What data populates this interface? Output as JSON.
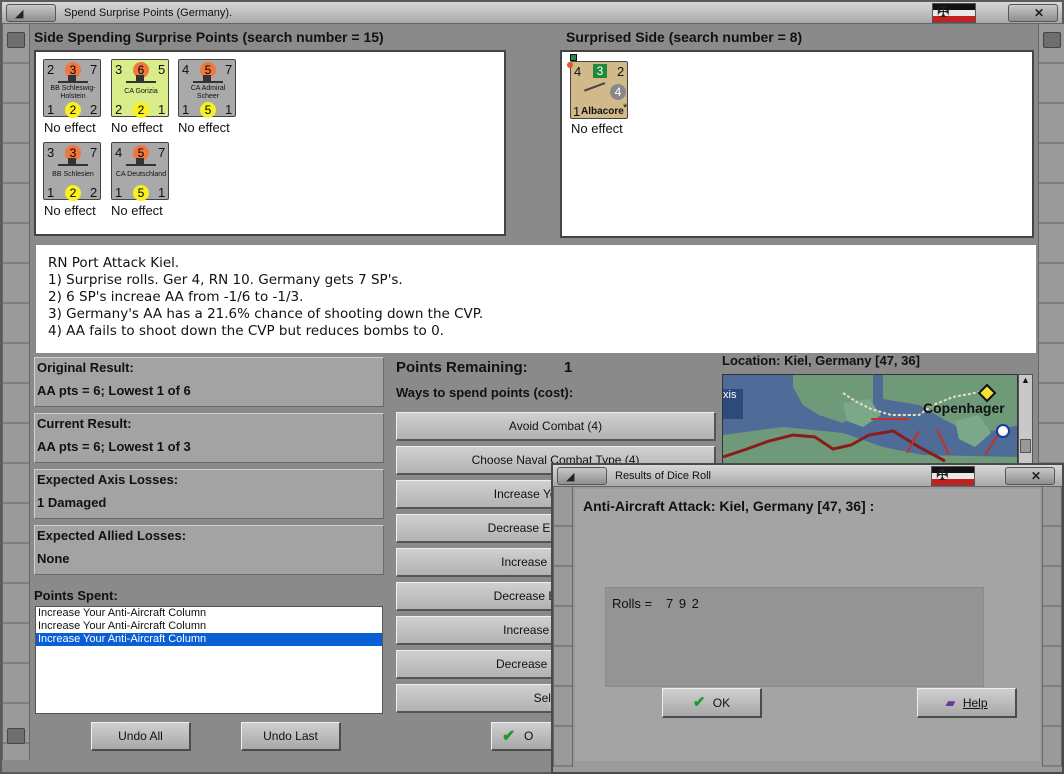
{
  "window": {
    "title": "Spend Surprise Points (Germany)."
  },
  "spending_side": {
    "label": "Side Spending Surprise Points (search number = 15)",
    "units": [
      {
        "top_left": "2",
        "top_mid": "3",
        "top_right": "7",
        "name_line1": "BB Schleswig-",
        "name_line2": "Holstein",
        "bot_left": "1",
        "bot_mid": "2",
        "bot_right": "2",
        "result": "No effect",
        "bg": "#a9a9a9"
      },
      {
        "top_left": "3",
        "top_mid": "6",
        "top_right": "5",
        "name_line1": "CA Gorizia",
        "name_line2": "",
        "bot_left": "2",
        "bot_mid": "2",
        "bot_right": "1",
        "result": "No effect",
        "bg": "#d8ec8a"
      },
      {
        "top_left": "4",
        "top_mid": "5",
        "top_right": "7",
        "name_line1": "CA Admiral",
        "name_line2": "Scheer",
        "bot_left": "1",
        "bot_mid": "5",
        "bot_right": "1",
        "result": "No effect",
        "bg": "#a9a9a9"
      },
      {
        "top_left": "3",
        "top_mid": "3",
        "top_right": "7",
        "name_line1": "BB Schlesien",
        "name_line2": "",
        "bot_left": "1",
        "bot_mid": "2",
        "bot_right": "2",
        "result": "No effect",
        "bg": "#a9a9a9"
      },
      {
        "top_left": "4",
        "top_mid": "5",
        "top_right": "7",
        "name_line1": "CA Deutschland",
        "name_line2": "",
        "bot_left": "1",
        "bot_mid": "5",
        "bot_right": "1",
        "result": "No effect",
        "bg": "#a9a9a9"
      }
    ]
  },
  "surprised_side": {
    "label": "Surprised Side (search number = 8)",
    "unit": {
      "top_left": "4",
      "top_mid": "3",
      "top_right": "2",
      "mid_right": "4",
      "bot_left": "1",
      "name": "Albacore",
      "star": "*",
      "result": "No effect",
      "bg": "#d2b98a"
    }
  },
  "summary_lines": [
    "RN Port Attack Kiel.",
    "1) Surprise rolls.  Ger 4, RN 10.  Germany gets 7 SP's.",
    "2) 6 SP's increae AA from -1/6 to -1/3.",
    "3) Germany's AA has a 21.6% chance of shooting down the CVP.",
    "4) AA fails to shoot down the CVP but reduces bombs to 0."
  ],
  "results": {
    "original_label": "Original Result:",
    "original_value": "AA pts = 6; Lowest 1 of 6",
    "current_label": "Current Result:",
    "current_value": "AA pts = 6; Lowest 1 of 3",
    "axis_label": "Expected Axis Losses:",
    "axis_value": "1 Damaged",
    "allied_label": "Expected Allied Losses:",
    "allied_value": "None"
  },
  "points_spent": {
    "label": "Points Spent:",
    "items": [
      "Increase Your Anti-Aircraft Column",
      "Increase Your Anti-Aircraft Column",
      "Increase Your Anti-Aircraft Column"
    ]
  },
  "buttons": {
    "undo_all": "Undo All",
    "undo_last": "Undo Last",
    "ok_partial": "O"
  },
  "points_remaining": {
    "label": "Points Remaining:",
    "value": "1",
    "ways_label": "Ways to spend points (cost):"
  },
  "spend_options": [
    "Avoid Combat (4)",
    "Choose Naval Combat Type (4)",
    "Increase Your Air-to-Air",
    "Decrease Enemy's Air-to-",
    "Increase Your Anti-A",
    "Decrease Enemy's Anti",
    "Increase Your Nava",
    "Decrease Enemy's Na",
    "Select T"
  ],
  "location": {
    "label": "Location: Kiel, Germany [47, 36]",
    "map_city": "Copenhager",
    "map_edge_text": "xis"
  },
  "dice_dialog": {
    "title": "Results of Dice Roll",
    "heading": "Anti-Aircraft Attack: Kiel, Germany [47, 36] :",
    "rolls_label": "Rolls =",
    "rolls_value": "7 9 2",
    "ok_label": "OK",
    "help_label": "Help"
  },
  "colors": {
    "orange_circle": "#f07840",
    "yellow_circle": "#f8f020",
    "selection": "#0a5fd4",
    "map_sea": "#4f6c98",
    "map_land": "#6f9a7a",
    "map_red_border": "#8b1c1c"
  }
}
